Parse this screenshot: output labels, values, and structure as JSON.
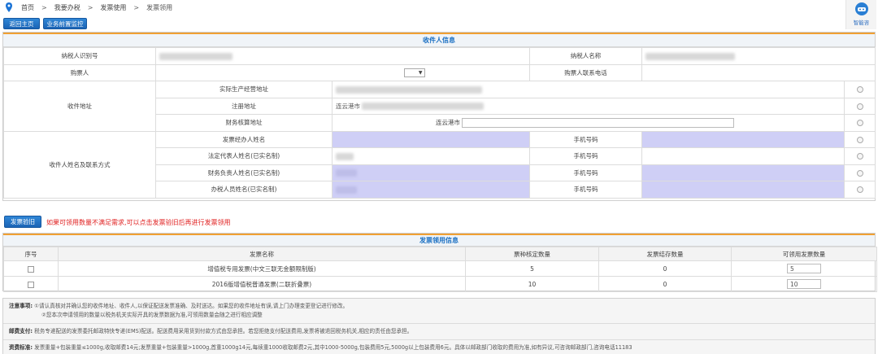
{
  "breadcrumb": [
    "首页",
    "我要办税",
    "发票使用",
    "发票领用"
  ],
  "assistant_label": "智能咨",
  "buttons": {
    "back_home": "返回主页",
    "monitor": "业务前置监控",
    "verify": "发票验旧"
  },
  "recipient": {
    "title": "收件人信息",
    "taxpayer_id_label": "纳税人识别号",
    "taxpayer_name_label": "纳税人名称",
    "buyer_label": "购票人",
    "buyer_select_caret": "▼",
    "buyer_phone_label": "购票人联系电话",
    "address_label": "收件地址",
    "address_options": [
      "实际生产经营地址",
      "注册地址",
      "财务核算地址"
    ],
    "registered_city": "连云港市",
    "finance_city": "连云港市",
    "contact_label": "收件人姓名及联系方式",
    "contacts": [
      {
        "label": "发票经办人姓名",
        "phone_label": "手机号码"
      },
      {
        "label": "法定代表人姓名(已实名制)",
        "phone_label": "手机号码"
      },
      {
        "label": "财务负责人姓名(已实名制)",
        "phone_label": "手机号码"
      },
      {
        "label": "办税人员姓名(已实名制)",
        "phone_label": "手机号码"
      }
    ]
  },
  "warning": "如果可领用数量不满足需求,可以点击发票验旧后再进行发票领用",
  "invoice": {
    "title": "发票领用信息",
    "headers": [
      "序号",
      "发票名称",
      "票种核定数量",
      "发票结存数量",
      "可领用发票数量"
    ],
    "rows": [
      {
        "name": "增值税专用发票(中文三联无金额限制版)",
        "approved": "5",
        "stock": "0",
        "available": "5"
      },
      {
        "name": "2016版增值税普通发票(二联折叠票)",
        "approved": "10",
        "stock": "0",
        "available": "10"
      }
    ]
  },
  "notes": {
    "caution_label": "注意事项:",
    "caution_1": "①请认真核对并确认您的收件地址、收件人,以保证配送发票准确、及时送达。如果您的收件地址有误,请上门办理变更登记进行修改。",
    "caution_2": "②您本次申请领用的数量以税务机关实际开具的发票数据为准,可领用数量会随之进行相应调整",
    "postage_label": "邮费支付:",
    "postage_text": "税务专递配送的发票委托邮政特快专递(EMS)配送。配送费用采用货到付款方式由您承担。若您拒绝支付配送费用,发票将被退回税务机关,相应的责任由您承担。",
    "fee_label": "资费标准:",
    "fee_text": "发票重量+包装重量≤1000g,收取邮费14元;发票重量+包装重量>1000g,首重1000g14元,每续重1000收取邮费2元,其中1000-5000g,包装费用5元,5000g以上包装费用6元。具体以邮政部门收取的费用为准,如有异议,可咨询邮政部门,咨询电话11183"
  }
}
